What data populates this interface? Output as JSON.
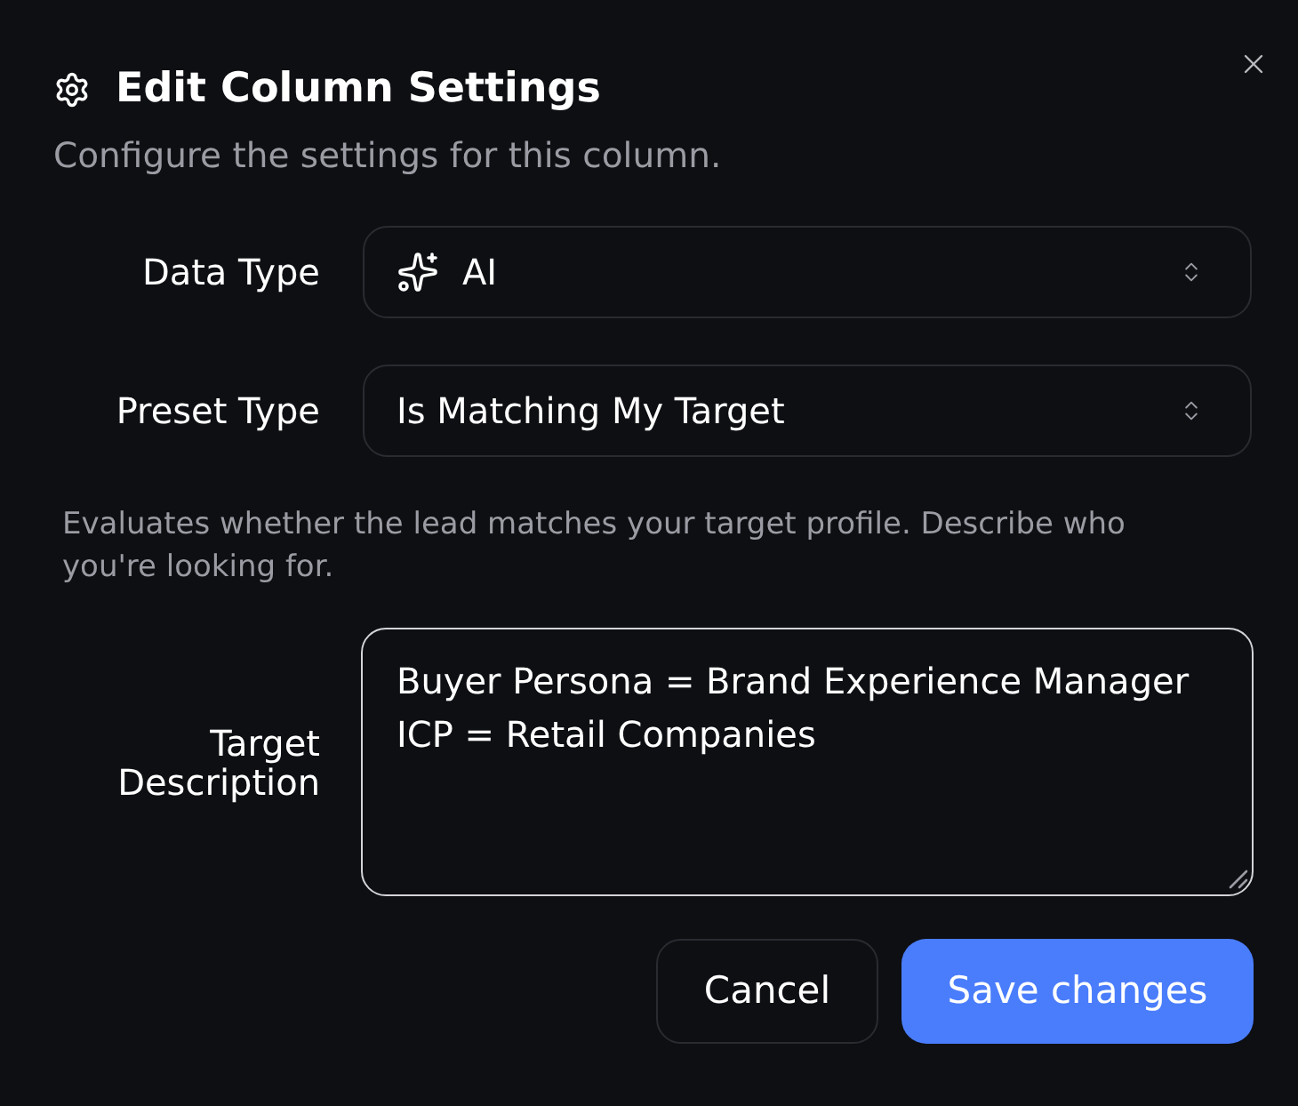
{
  "dialog": {
    "title": "Edit Column Settings",
    "subtitle": "Configure the settings for this column."
  },
  "fields": [
    {
      "kind": "select",
      "label": "Data Type",
      "value": "AI",
      "show_icon": true
    },
    {
      "kind": "select",
      "label": "Preset Type",
      "value": "Is Matching My Target",
      "show_icon": false
    },
    {
      "kind": "note",
      "text": "Evaluates whether the lead matches your target profile. Describe who you're looking for."
    },
    {
      "kind": "textarea",
      "label": "Target Description",
      "value": "Buyer Persona = Brand Experience Manager\nICP = Retail Companies",
      "focused": true
    }
  ],
  "buttons": [
    {
      "kind": "secondary",
      "label": "Cancel"
    },
    {
      "kind": "primary",
      "label": "Save changes"
    }
  ]
}
